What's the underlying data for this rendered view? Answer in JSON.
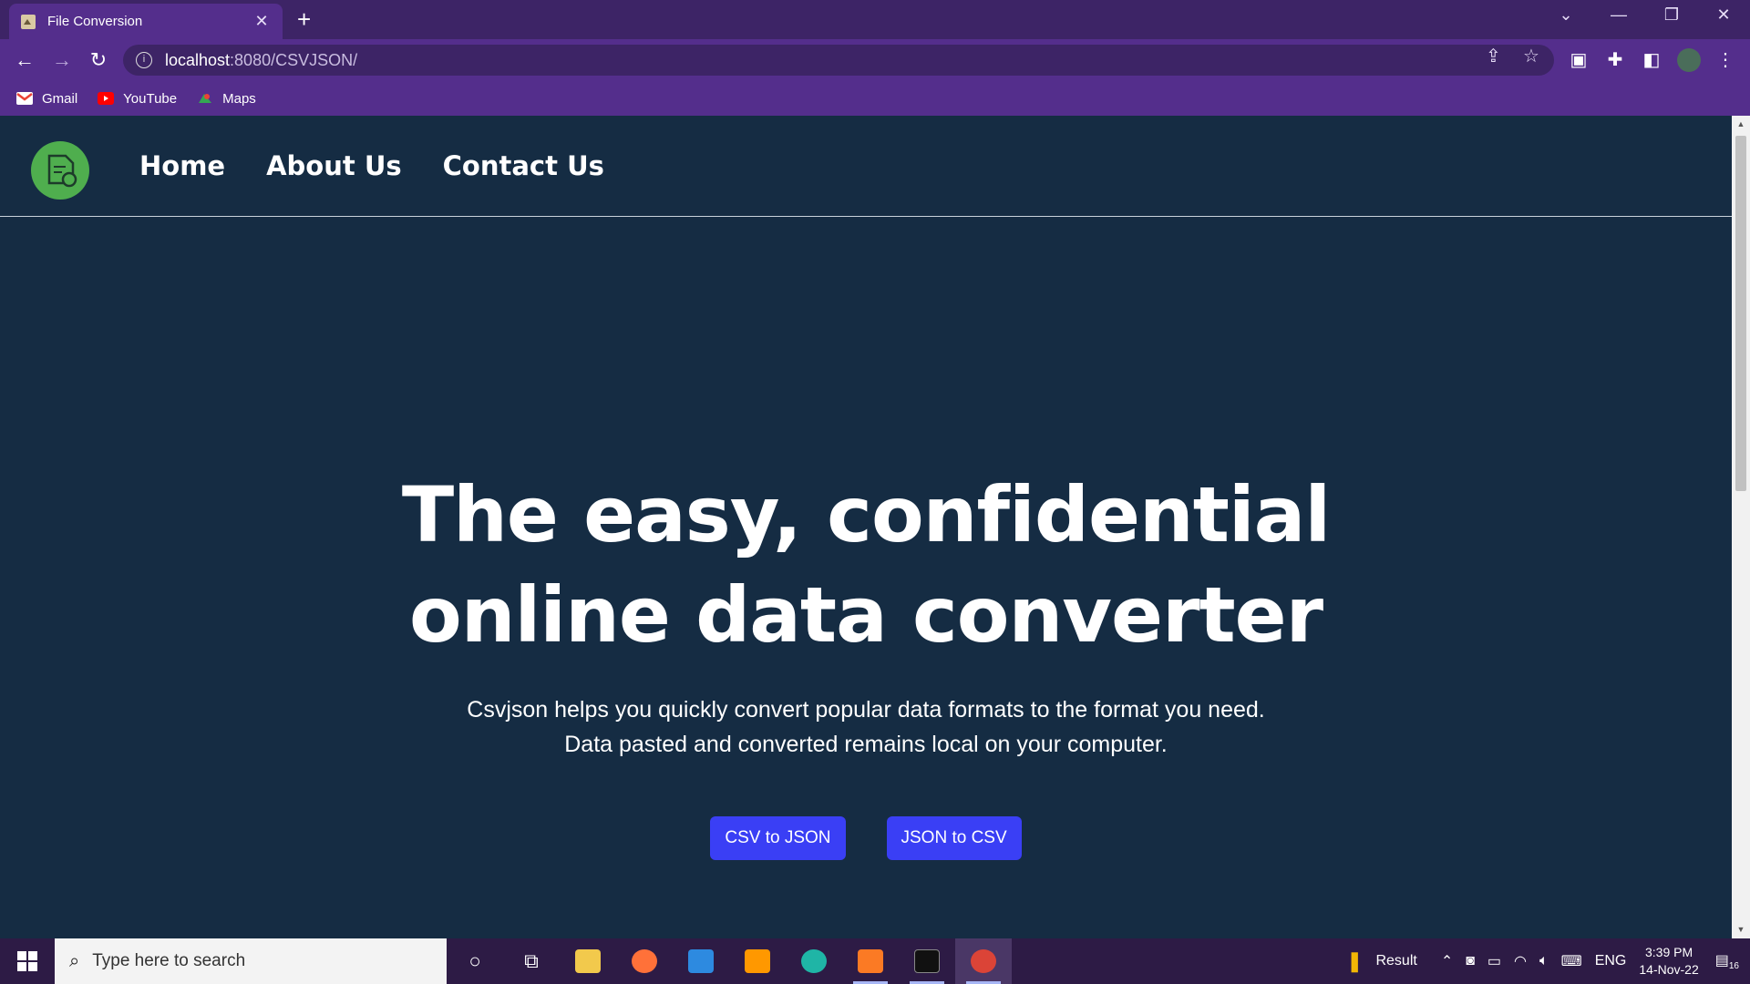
{
  "browser": {
    "tab_title": "File Conversion",
    "tab_close": "✕",
    "new_tab": "+",
    "url_host": "localhost",
    "url_rest": ":8080/CSVJSON/",
    "bookmarks": [
      {
        "label": "Gmail",
        "icon": "gmail-icon",
        "color": "#ea4335"
      },
      {
        "label": "YouTube",
        "icon": "youtube-icon",
        "color": "#ff0000"
      },
      {
        "label": "Maps",
        "icon": "maps-icon",
        "color": "#34a853"
      }
    ]
  },
  "nav": {
    "links": [
      "Home",
      "About Us",
      "Contact Us"
    ]
  },
  "hero": {
    "title_line1": "The easy, confidential",
    "title_line2": "online data converter",
    "subtitle_line1": "Csvjson helps you quickly convert popular data formats to the format you need.",
    "subtitle_line2": "Data pasted and converted remains local on your computer.",
    "btn_csv_to_json": "CSV to JSON",
    "btn_json_to_csv": "JSON to CSV"
  },
  "taskbar": {
    "search_placeholder": "Type here to search",
    "tray_app": "Result",
    "lang": "ENG",
    "time": "3:39 PM",
    "date": "14-Nov-22",
    "notifications": "16"
  },
  "colors": {
    "page_bg": "#152c43",
    "chrome_bg": "#542e8c",
    "button": "#3a3ff5",
    "logo": "#4fae4e"
  }
}
